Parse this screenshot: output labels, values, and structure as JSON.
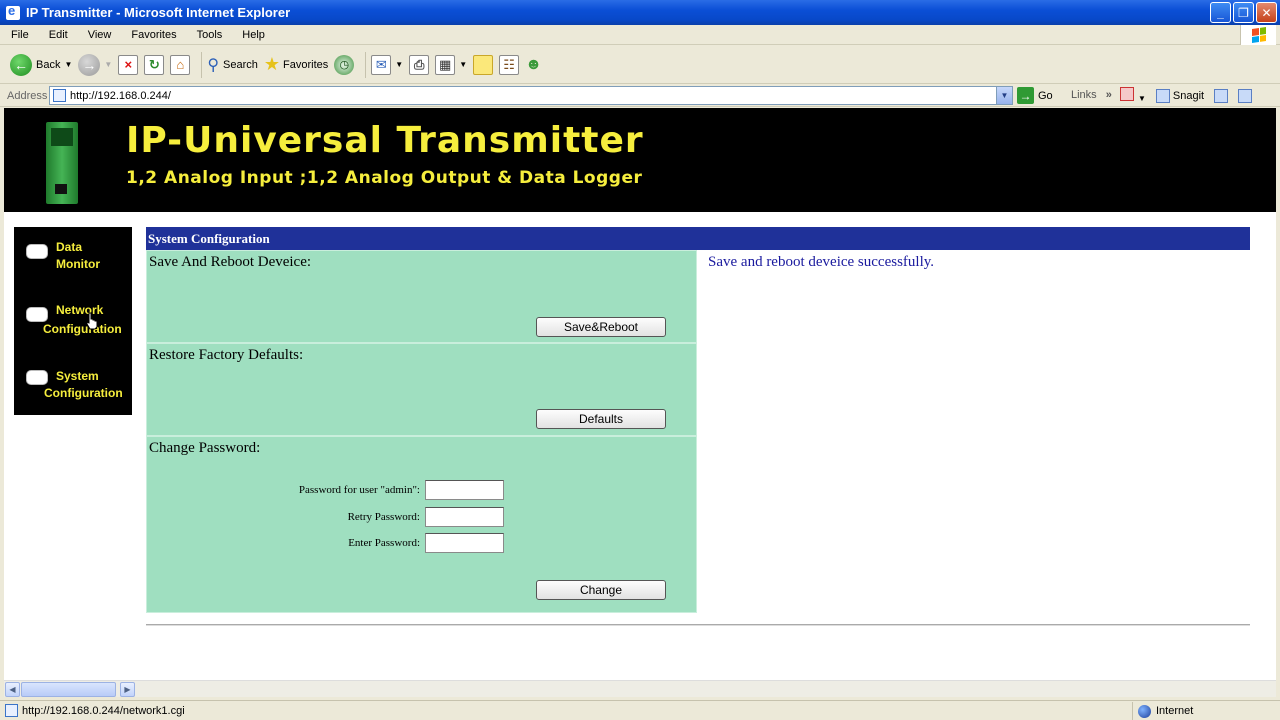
{
  "window": {
    "title": "IP Transmitter - Microsoft Internet Explorer",
    "minimize": "_",
    "maximize": "❐",
    "close": "✕"
  },
  "menu": [
    "File",
    "Edit",
    "View",
    "Favorites",
    "Tools",
    "Help"
  ],
  "toolbar": {
    "back_label": "Back",
    "search_label": "Search",
    "favorites_label": "Favorites"
  },
  "address": {
    "label": "Address",
    "url": "http://192.168.0.244/",
    "go_label": "Go",
    "links_label": "Links",
    "snagit_label": "Snagit"
  },
  "banner": {
    "title": "IP-Universal Transmitter",
    "subtitle": "1,2 Analog Input ;1,2 Analog Output & Data Logger"
  },
  "sidebar": {
    "items": [
      {
        "line1": "Data",
        "line2": "Monitor"
      },
      {
        "line1": "Network",
        "line2": "Configuration"
      },
      {
        "line1": "System",
        "line2": "Configuration"
      }
    ]
  },
  "panel": {
    "header": "System Configuration",
    "save_title": "Save And Reboot Deveice:",
    "save_button": "Save&Reboot",
    "restore_title": "Restore Factory Defaults:",
    "defaults_button": "Defaults",
    "password_title": "Change Password:",
    "pw_user_label": "Password for user \"admin\":",
    "pw_retry_label": "Retry Password:",
    "pw_enter_label": "Enter Password:",
    "pw_user_value": "",
    "pw_retry_value": "",
    "pw_enter_value": "",
    "change_button": "Change",
    "status_message": "Save and reboot deveice successfully."
  },
  "statusbar": {
    "url": "http://192.168.0.244/network1.cgi",
    "zone": "Internet"
  },
  "colors": {
    "banner_text": "#f6ee3d",
    "panel_header": "#1f3199",
    "section_bg": "#9fdfc0",
    "status_text": "#1a1a9e"
  }
}
